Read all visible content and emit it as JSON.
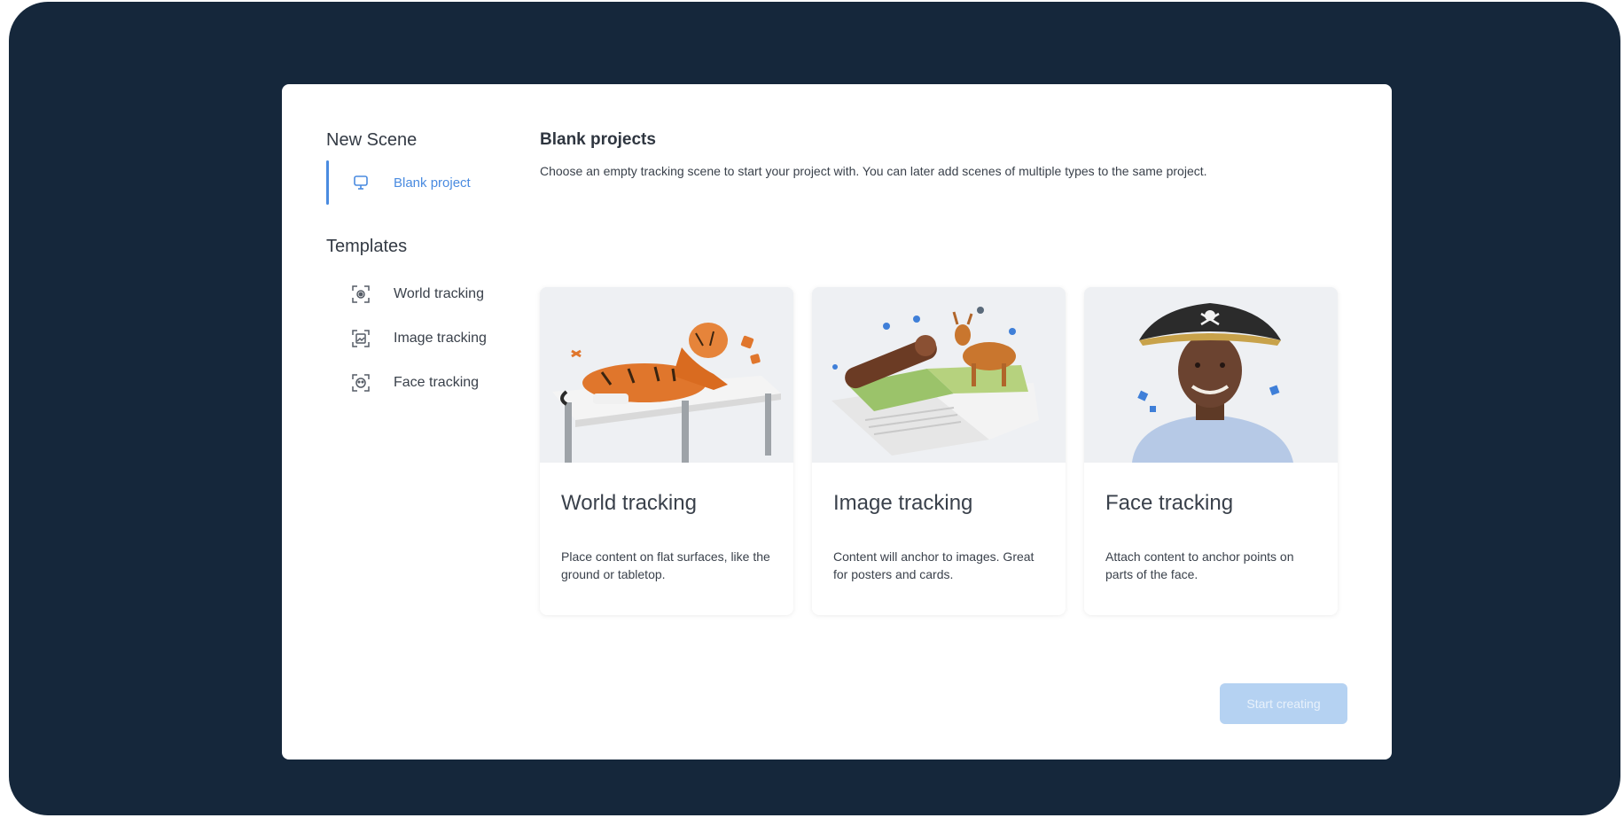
{
  "sidebar": {
    "new_scene_heading": "New Scene",
    "blank_item": {
      "label": "Blank project",
      "icon": "tablet-stand-icon"
    },
    "templates_heading": "Templates",
    "templates": [
      {
        "label": "World tracking",
        "icon": "world-tracking-icon"
      },
      {
        "label": "Image tracking",
        "icon": "image-tracking-icon"
      },
      {
        "label": "Face tracking",
        "icon": "face-tracking-icon"
      }
    ]
  },
  "main": {
    "title": "Blank projects",
    "description": "Choose an empty tracking scene to start your project with. You can later add scenes of multiple types to the same project.",
    "cards": [
      {
        "title": "World tracking",
        "description": "Place content on flat surfaces, like the ground or tabletop.",
        "image": "tiger-on-table"
      },
      {
        "title": "Image tracking",
        "description": "Content will anchor to images. Great for posters and cards.",
        "image": "deer-on-book"
      },
      {
        "title": "Face tracking",
        "description": "Attach content to anchor points on parts of the face.",
        "image": "man-with-pirate-hat"
      }
    ]
  },
  "footer": {
    "start_label": "Start creating"
  },
  "colors": {
    "frame": "#15273b",
    "accent": "#4a8be0",
    "button_disabled": "#b5d2f2"
  }
}
